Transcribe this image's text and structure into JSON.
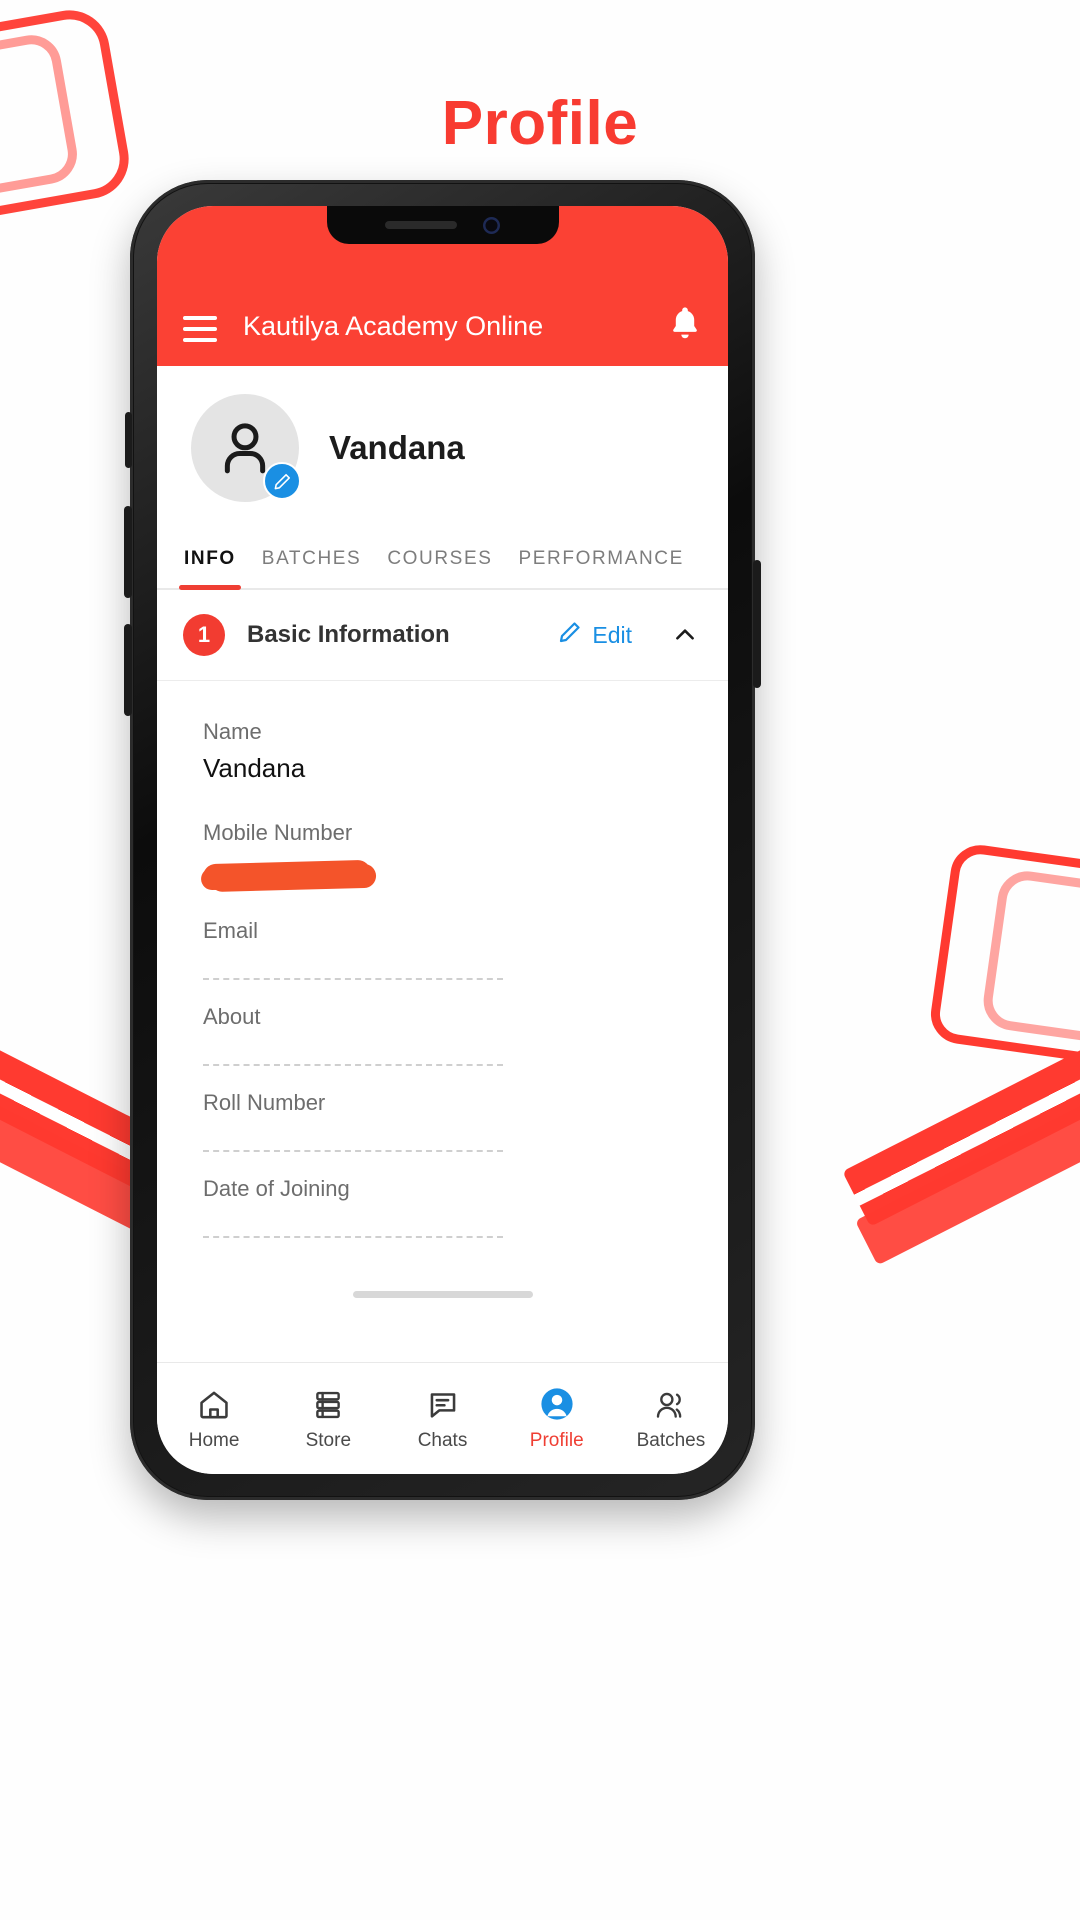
{
  "poster": {
    "title": "Profile",
    "title_color": "#f83b31",
    "background": "#fefefe",
    "accent_color": "#ff3a30"
  },
  "app": {
    "appbar": {
      "menu_icon": "hamburger-menu-icon",
      "title": "Kautilya Academy Online",
      "notification_icon": "bell-icon",
      "background": "#fb4134",
      "text_color": "#ffffff"
    },
    "profile": {
      "avatar_icon": "person-avatar-icon",
      "edit_badge_icon": "pencil-edit-icon",
      "edit_badge_color": "#1a8fe3",
      "name": "Vandana"
    },
    "tabs": [
      {
        "label": "INFO",
        "active": true
      },
      {
        "label": "BATCHES",
        "active": false
      },
      {
        "label": "COURSES",
        "active": false
      },
      {
        "label": "PERFORMANCE",
        "active": false
      }
    ],
    "section": {
      "step": "1",
      "title": "Basic Information",
      "edit_label": "Edit",
      "edit_icon": "pencil-icon",
      "collapse_icon": "chevron-up-icon",
      "link_color": "#1a8fe3",
      "badge_color": "#f23c31"
    },
    "fields": [
      {
        "label": "Name",
        "value": "Vandana",
        "state": "filled"
      },
      {
        "label": "Mobile Number",
        "value": "",
        "state": "redacted"
      },
      {
        "label": "Email",
        "value": "",
        "state": "empty"
      },
      {
        "label": "About",
        "value": "",
        "state": "empty"
      },
      {
        "label": "Roll Number",
        "value": "",
        "state": "empty"
      },
      {
        "label": "Date of Joining",
        "value": "",
        "state": "empty"
      }
    ],
    "bottom_nav": [
      {
        "label": "Home",
        "icon": "home-icon",
        "active": false
      },
      {
        "label": "Store",
        "icon": "books-icon",
        "active": false
      },
      {
        "label": "Chats",
        "icon": "chat-icon",
        "active": false
      },
      {
        "label": "Profile",
        "icon": "person-icon",
        "active": true
      },
      {
        "label": "Batches",
        "icon": "people-icon",
        "active": false
      }
    ]
  }
}
